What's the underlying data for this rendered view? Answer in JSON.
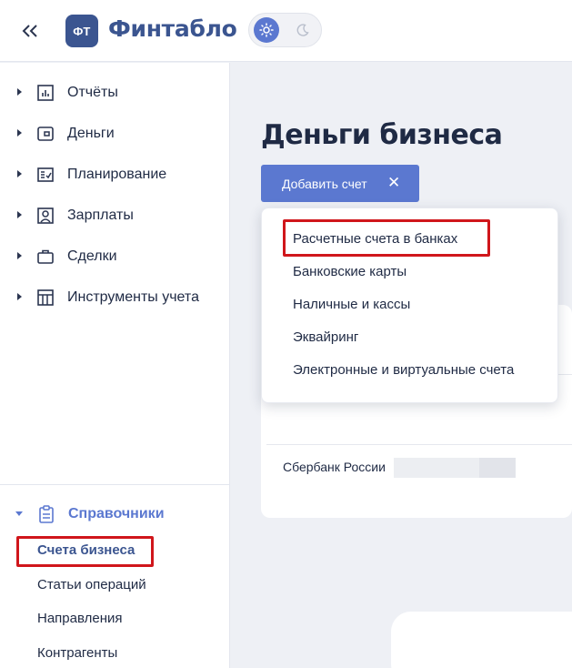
{
  "header": {
    "collapse_icon": "double-chevron-left-icon",
    "logo_text": "ФТ",
    "brand": "Финтабло",
    "theme": {
      "light_icon": "sun-icon",
      "dark_icon": "moon-icon",
      "selected": "light"
    }
  },
  "sidebar": {
    "items": [
      {
        "label": "Отчёты",
        "icon": "bar-chart-icon"
      },
      {
        "label": "Деньги",
        "icon": "wallet-icon"
      },
      {
        "label": "Планирование",
        "icon": "checklist-icon"
      },
      {
        "label": "Зарплаты",
        "icon": "user-card-icon"
      },
      {
        "label": "Сделки",
        "icon": "briefcase-icon"
      },
      {
        "label": "Инструменты учета",
        "icon": "table-icon"
      }
    ],
    "reference": {
      "label": "Справочники",
      "icon": "clipboard-icon",
      "subitems": [
        {
          "label": "Счета бизнеса",
          "active": true
        },
        {
          "label": "Статьи операций",
          "active": false
        },
        {
          "label": "Направления",
          "active": false
        },
        {
          "label": "Контрагенты",
          "active": false
        }
      ]
    }
  },
  "main": {
    "title": "Деньги бизнеса",
    "add_button": {
      "label": "Добавить счет",
      "close": "✕"
    },
    "dropdown": [
      "Расчетные счета в банках",
      "Банковские карты",
      "Наличные и кассы",
      "Эквайринг",
      "Электронные и виртуальные счета"
    ],
    "account_row": {
      "bank": "Сбербанк России"
    }
  },
  "colors": {
    "accent": "#5b78d0",
    "brand": "#3b5590",
    "highlight": "#d0161b"
  }
}
